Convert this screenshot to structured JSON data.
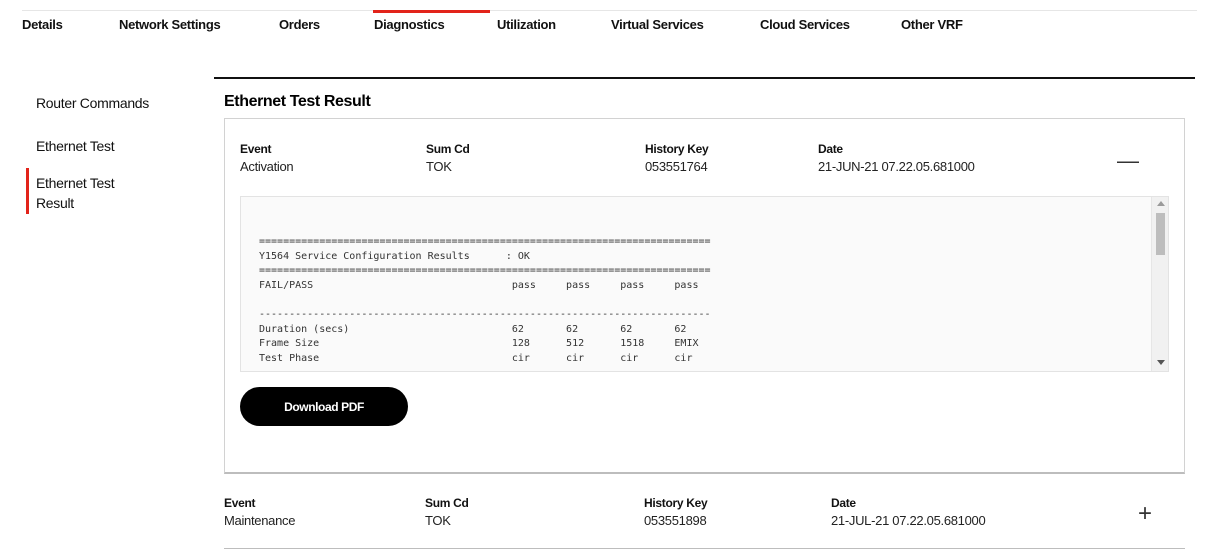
{
  "tabs": [
    {
      "label": "Details"
    },
    {
      "label": "Network Settings"
    },
    {
      "label": "Orders"
    },
    {
      "label": "Diagnostics",
      "active": true
    },
    {
      "label": "Utilization"
    },
    {
      "label": "Virtual Services"
    },
    {
      "label": "Cloud Services"
    },
    {
      "label": "Other VRF"
    }
  ],
  "sidebar": {
    "items": [
      {
        "label": "Router Commands"
      },
      {
        "label": "Ethernet Test"
      },
      {
        "label": "Ethernet Test\nResult",
        "active": true
      }
    ]
  },
  "main": {
    "title": "Ethernet Test Result"
  },
  "columns": {
    "event": "Event",
    "sum_cd": "Sum Cd",
    "history_key": "History Key",
    "date": "Date"
  },
  "results": [
    {
      "event": "Activation",
      "sum_cd": "TOK",
      "history_key": "053551764",
      "date": "21-JUN-21 07.22.05.681000",
      "toggle": "—",
      "expanded": true,
      "log": "===========================================================================\nY1564 Service Configuration Results      : OK\n===========================================================================\nFAIL/PASS                                 pass     pass     pass     pass\n\n---------------------------------------------------------------------------\nDuration (secs)                           62       62       62       62\nFrame Size                                128      512      1518     EMIX\nTest Phase                                cir      cir      cir      cir"
    },
    {
      "event": "Maintenance",
      "sum_cd": "TOK",
      "history_key": "053551898",
      "date": "21-JUL-21 07.22.05.681000",
      "toggle": "+",
      "expanded": false
    }
  ],
  "download_label": "Download PDF",
  "colors": {
    "accent": "#e2231a",
    "button": "#000000"
  }
}
